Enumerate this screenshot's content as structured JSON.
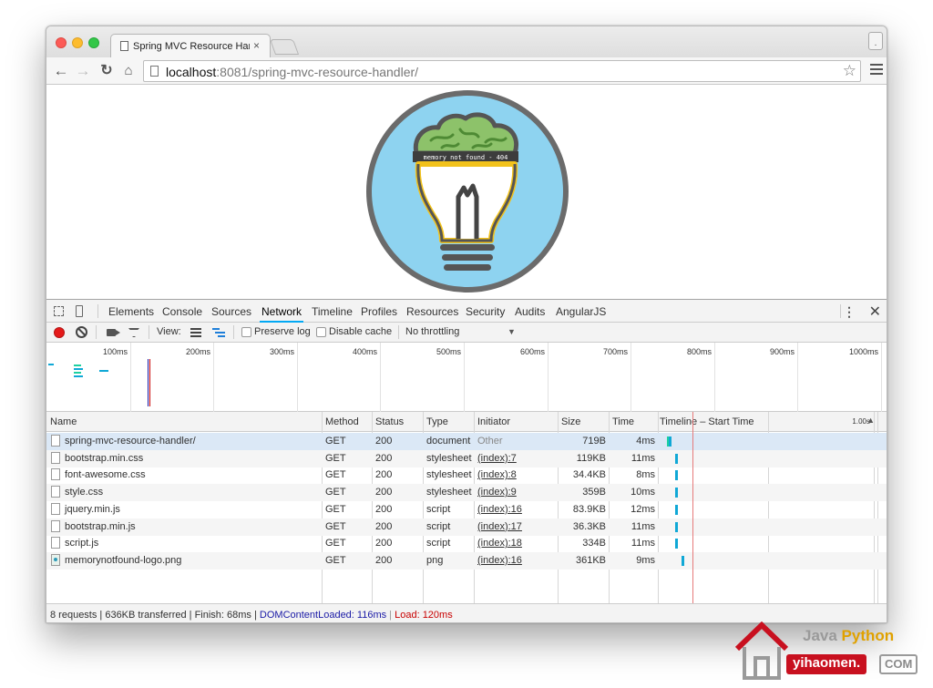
{
  "browser": {
    "tab_title": "Spring MVC Resource Han",
    "tab_close": "×",
    "profile_label": ".",
    "url_host": "localhost",
    "url_rest": ":8081/spring-mvc-resource-handler/",
    "nav": {
      "back": "←",
      "forward": "→",
      "reload": "↻",
      "home": "⌂",
      "star": "☆"
    }
  },
  "page": {
    "logo_caption": "memory not found - 404",
    "colors": {
      "logo_bg": "#8ed3f0",
      "logo_ring": "#6b6b6b",
      "brain": "#8dc26a",
      "bulb_outline": "#f2c21b"
    }
  },
  "devtools": {
    "tabs": [
      "Elements",
      "Console",
      "Sources",
      "Network",
      "Timeline",
      "Profiles",
      "Resources",
      "Security",
      "Audits",
      "AngularJS"
    ],
    "active_tab": "Network",
    "kebab": "⋮",
    "close": "✕",
    "controls": {
      "view_label": "View:",
      "preserve_log": "Preserve log",
      "disable_cache": "Disable cache",
      "throttling": "No throttling",
      "select_arrow": "▼"
    },
    "overview_ticks": [
      "100ms",
      "200ms",
      "300ms",
      "400ms",
      "500ms",
      "600ms",
      "700ms",
      "800ms",
      "900ms",
      "1000ms"
    ],
    "columns": {
      "name": "Name",
      "method": "Method",
      "status": "Status",
      "type": "Type",
      "initiator": "Initiator",
      "size": "Size",
      "time": "Time",
      "timeline": "Timeline – Start Time",
      "scale": "1.00s",
      "sort": "▲"
    },
    "requests": [
      {
        "name": "spring-mvc-resource-handler/",
        "method": "GET",
        "status": "200",
        "type": "document",
        "initiator": "Other",
        "size": "719B",
        "time": "4ms",
        "icon": "document-icon"
      },
      {
        "name": "bootstrap.min.css",
        "method": "GET",
        "status": "200",
        "type": "stylesheet",
        "initiator": "(index):7",
        "size": "119KB",
        "time": "11ms",
        "icon": "document-icon"
      },
      {
        "name": "font-awesome.css",
        "method": "GET",
        "status": "200",
        "type": "stylesheet",
        "initiator": "(index):8",
        "size": "34.4KB",
        "time": "8ms",
        "icon": "document-icon"
      },
      {
        "name": "style.css",
        "method": "GET",
        "status": "200",
        "type": "stylesheet",
        "initiator": "(index):9",
        "size": "359B",
        "time": "10ms",
        "icon": "document-icon"
      },
      {
        "name": "jquery.min.js",
        "method": "GET",
        "status": "200",
        "type": "script",
        "initiator": "(index):16",
        "size": "83.9KB",
        "time": "12ms",
        "icon": "document-icon"
      },
      {
        "name": "bootstrap.min.js",
        "method": "GET",
        "status": "200",
        "type": "script",
        "initiator": "(index):17",
        "size": "36.3KB",
        "time": "11ms",
        "icon": "document-icon"
      },
      {
        "name": "script.js",
        "method": "GET",
        "status": "200",
        "type": "script",
        "initiator": "(index):18",
        "size": "334B",
        "time": "11ms",
        "icon": "document-icon"
      },
      {
        "name": "memorynotfound-logo.png",
        "method": "GET",
        "status": "200",
        "type": "png",
        "initiator": "(index):16",
        "size": "361KB",
        "time": "9ms",
        "icon": "image-icon"
      }
    ],
    "status_bar": {
      "summary": "8 requests | 636KB transferred | Finish: 68ms | ",
      "dom_loaded": "DOMContentLoaded: 116ms",
      "separator": " | ",
      "load": "Load: 120ms"
    }
  },
  "watermark": {
    "java": "Java ",
    "python": "Python",
    "site": "yihaomen.",
    "tld": "COM"
  }
}
